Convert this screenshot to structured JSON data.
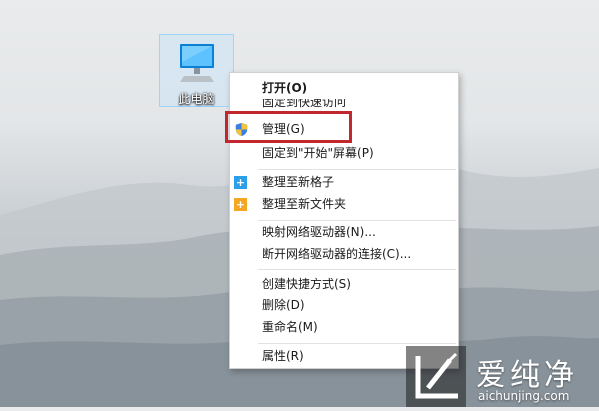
{
  "desktop": {
    "icon_label": "此电脑",
    "icon_name": "computer-monitor-icon"
  },
  "context_menu": {
    "items": [
      {
        "label": "打开(O)",
        "bold": true
      },
      {
        "label": "固定到快速访问",
        "partially_hidden": true
      },
      {
        "label": "管理(G)",
        "icon": "uac-shield-icon",
        "highlighted": true
      },
      {
        "label": "固定到\"开始\"屏幕(P)"
      },
      {
        "label": "整理至新格子",
        "icon": "plus-icon",
        "icon_color": "#2d9fe9"
      },
      {
        "label": "整理至新文件夹",
        "icon": "plus-icon",
        "icon_color": "#f5a623"
      },
      {
        "label": "映射网络驱动器(N)..."
      },
      {
        "label": "断开网络驱动器的连接(C)..."
      },
      {
        "label": "创建快捷方式(S)"
      },
      {
        "label": "删除(D)"
      },
      {
        "label": "重命名(M)"
      },
      {
        "label": "属性(R)"
      }
    ]
  },
  "annotation": {
    "highlight_color": "#c1272d"
  },
  "watermark": {
    "brand_cn": "爱纯净",
    "url": "aichunjing.com"
  }
}
